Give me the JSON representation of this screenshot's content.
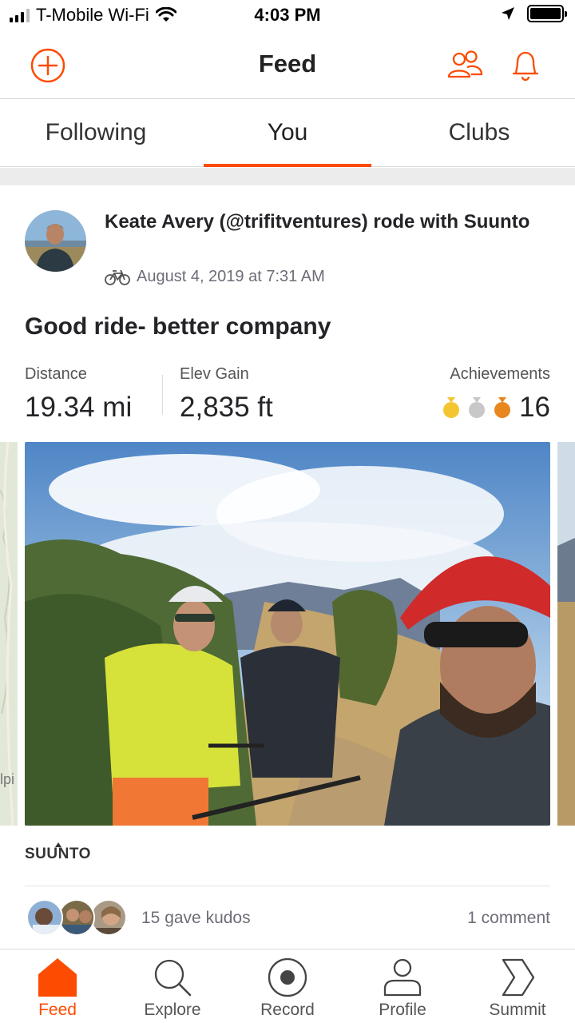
{
  "status_bar": {
    "carrier": "T-Mobile Wi-Fi",
    "time": "4:03 PM"
  },
  "header": {
    "title": "Feed",
    "accent_color": "#fc4c02"
  },
  "tabs": [
    {
      "label": "Following",
      "active": false
    },
    {
      "label": "You",
      "active": true
    },
    {
      "label": "Clubs",
      "active": false
    }
  ],
  "activity": {
    "athlete_line": "Keate Avery (@trifitventures) rode with Suunto",
    "date": "August 4, 2019 at 7:31 AM",
    "title": "Good ride- better company",
    "stats": {
      "distance_label": "Distance",
      "distance_value": "19.34 mi",
      "elev_label": "Elev Gain",
      "elev_value": "2,835 ft",
      "achievements_label": "Achievements",
      "achievements_value": "16",
      "medal_colors": [
        "#f5c531",
        "#c8c8c8",
        "#e8871e"
      ]
    },
    "map_fragment_text": "lpi",
    "device": "SUUNTO",
    "kudos_text": "15 gave kudos",
    "comments_text": "1 comment"
  },
  "bottom_nav": [
    {
      "label": "Feed",
      "icon": "home-icon",
      "active": true
    },
    {
      "label": "Explore",
      "icon": "search-icon",
      "active": false
    },
    {
      "label": "Record",
      "icon": "record-icon",
      "active": false
    },
    {
      "label": "Profile",
      "icon": "profile-icon",
      "active": false
    },
    {
      "label": "Summit",
      "icon": "summit-icon",
      "active": false
    }
  ]
}
